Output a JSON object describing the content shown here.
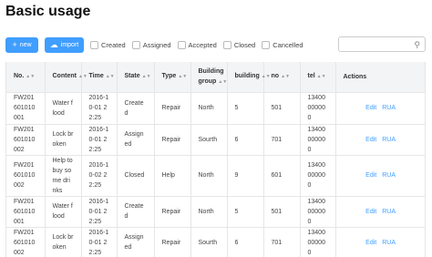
{
  "page": {
    "title": "Basic usage"
  },
  "toolbar": {
    "new_label": "new",
    "import_label": "import",
    "filters": [
      "Created",
      "Assigned",
      "Accepted",
      "Closed",
      "Cancelled"
    ],
    "search_placeholder": ""
  },
  "table": {
    "headers": {
      "no": "No.",
      "content": "Content",
      "time": "Time",
      "state": "State",
      "type": "Type",
      "building_group": "Building group",
      "building": "building",
      "no2": "no",
      "tel": "tel",
      "actions": "Actions"
    },
    "rows": [
      {
        "no": "FW201601010001",
        "content": "Water flood",
        "time": "2016-10-01 22:25",
        "state": "Created",
        "type": "Repair",
        "building_group": "North",
        "building": "5",
        "no2": "501",
        "tel": "13400000000",
        "edit": "Edit",
        "rua": "RUA"
      },
      {
        "no": "FW201601010002",
        "content": "Lock broken",
        "time": "2016-10-01 22:25",
        "state": "Assigned",
        "type": "Repair",
        "building_group": "Sourth",
        "building": "6",
        "no2": "701",
        "tel": "13400000000",
        "edit": "Edit",
        "rua": "RUA"
      },
      {
        "no": "FW201601010002",
        "content": "Help to buy some drinks",
        "time": "2016-10-02 22:25",
        "state": "Closed",
        "type": "Help",
        "building_group": "North",
        "building": "9",
        "no2": "601",
        "tel": "13400000000",
        "edit": "Edit",
        "rua": "RUA"
      },
      {
        "no": "FW201601010001",
        "content": "Water flood",
        "time": "2016-10-01 22:25",
        "state": "Created",
        "type": "Repair",
        "building_group": "North",
        "building": "5",
        "no2": "501",
        "tel": "13400000000",
        "edit": "Edit",
        "rua": "RUA"
      },
      {
        "no": "FW201601010002",
        "content": "Lock broken",
        "time": "2016-10-01 22:25",
        "state": "Assigned",
        "type": "Repair",
        "building_group": "Sourth",
        "building": "6",
        "no2": "701",
        "tel": "13400000000",
        "edit": "Edit",
        "rua": "RUA"
      }
    ]
  },
  "colors": {
    "primary": "#409eff",
    "header_bg": "#f3f4f6",
    "border": "#e6e6e6"
  },
  "icons": {
    "new": "plus-icon",
    "import": "cloud-upload-icon",
    "search": "search-icon",
    "sort": "sort-caret-icon"
  }
}
